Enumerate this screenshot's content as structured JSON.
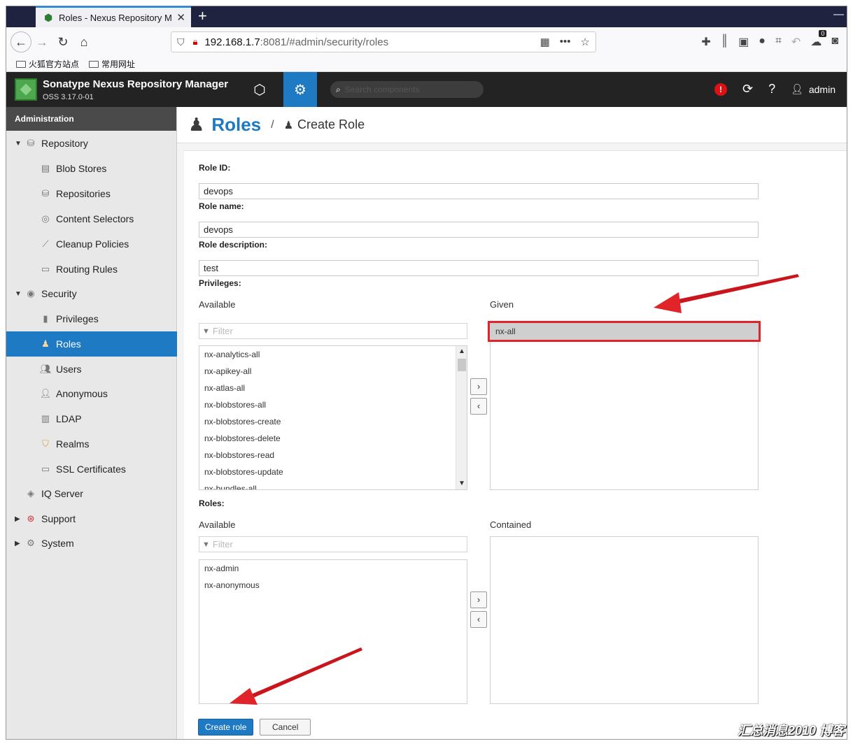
{
  "browser": {
    "tab_title": "Roles - Nexus Repository Manager",
    "new_tab": "+",
    "url_host": "192.168.1.7",
    "url_rest": ":8081/#admin/security/roles",
    "bookmarks": [
      "火狐官方站点",
      "常用网址"
    ],
    "sync_badge": "0"
  },
  "header": {
    "app_title": "Sonatype Nexus Repository Manager",
    "version": "OSS 3.17.0-01",
    "search_placeholder": "Search components",
    "user": "admin"
  },
  "sidebar": {
    "title": "Administration",
    "items": [
      {
        "label": "Repository",
        "level": 0,
        "expanded": true
      },
      {
        "label": "Blob Stores",
        "level": 1
      },
      {
        "label": "Repositories",
        "level": 1
      },
      {
        "label": "Content Selectors",
        "level": 1
      },
      {
        "label": "Cleanup Policies",
        "level": 1
      },
      {
        "label": "Routing Rules",
        "level": 1
      },
      {
        "label": "Security",
        "level": 0,
        "expanded": true
      },
      {
        "label": "Privileges",
        "level": 1
      },
      {
        "label": "Roles",
        "level": 1,
        "active": true
      },
      {
        "label": "Users",
        "level": 1
      },
      {
        "label": "Anonymous",
        "level": 1
      },
      {
        "label": "LDAP",
        "level": 1
      },
      {
        "label": "Realms",
        "level": 1
      },
      {
        "label": "SSL Certificates",
        "level": 1
      },
      {
        "label": "IQ Server",
        "level": 0
      },
      {
        "label": "Support",
        "level": 0,
        "expanded": false
      },
      {
        "label": "System",
        "level": 0,
        "expanded": false
      }
    ]
  },
  "breadcrumb": {
    "section": "Roles",
    "separator": "/",
    "page": "Create Role"
  },
  "form": {
    "role_id_label": "Role ID:",
    "role_id_value": "devops",
    "role_name_label": "Role name:",
    "role_name_value": "devops",
    "role_desc_label": "Role description:",
    "role_desc_value": "test",
    "privileges_label": "Privileges:",
    "priv_available_label": "Available",
    "priv_given_label": "Given",
    "filter_placeholder": "Filter",
    "priv_available": [
      "nx-analytics-all",
      "nx-apikey-all",
      "nx-atlas-all",
      "nx-blobstores-all",
      "nx-blobstores-create",
      "nx-blobstores-delete",
      "nx-blobstores-read",
      "nx-blobstores-update",
      "nx-bundles-all"
    ],
    "priv_given": [
      "nx-all"
    ],
    "roles_label": "Roles:",
    "roles_available_label": "Available",
    "roles_contained_label": "Contained",
    "roles_available": [
      "nx-admin",
      "nx-anonymous"
    ],
    "move_right": "›",
    "move_left": "‹",
    "create_button": "Create role",
    "cancel_button": "Cancel"
  },
  "watermark": "汇总消息2010 博客",
  "colors": {
    "accent": "#1f7ac4",
    "annotation": "#e0242a",
    "header_bg": "#232323"
  }
}
